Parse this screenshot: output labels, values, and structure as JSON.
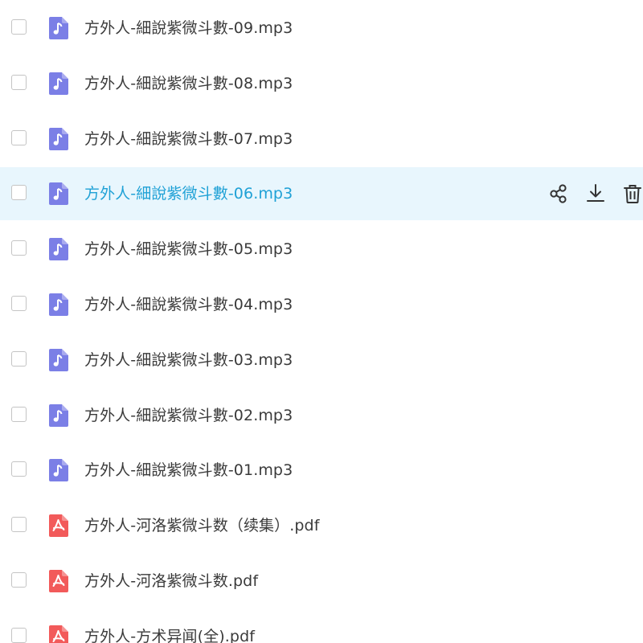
{
  "files": [
    {
      "name": "方外人-細說紫微斗數-09.mp3",
      "type": "audio",
      "icon": "music-note-icon",
      "selected": false
    },
    {
      "name": "方外人-細說紫微斗數-08.mp3",
      "type": "audio",
      "icon": "music-note-icon",
      "selected": false
    },
    {
      "name": "方外人-細說紫微斗數-07.mp3",
      "type": "audio",
      "icon": "music-note-icon",
      "selected": false
    },
    {
      "name": "方外人-細說紫微斗數-06.mp3",
      "type": "audio",
      "icon": "music-note-icon",
      "selected": true
    },
    {
      "name": "方外人-細說紫微斗數-05.mp3",
      "type": "audio",
      "icon": "music-note-icon",
      "selected": false
    },
    {
      "name": "方外人-細說紫微斗數-04.mp3",
      "type": "audio",
      "icon": "music-note-icon",
      "selected": false
    },
    {
      "name": "方外人-細說紫微斗數-03.mp3",
      "type": "audio",
      "icon": "music-note-icon",
      "selected": false
    },
    {
      "name": "方外人-細說紫微斗數-02.mp3",
      "type": "audio",
      "icon": "music-note-icon",
      "selected": false
    },
    {
      "name": "方外人-細說紫微斗數-01.mp3",
      "type": "audio",
      "icon": "music-note-icon",
      "selected": false
    },
    {
      "name": "方外人-河洛紫微斗数（续集）.pdf",
      "type": "pdf",
      "icon": "pdf-icon",
      "selected": false
    },
    {
      "name": "方外人-河洛紫微斗数.pdf",
      "type": "pdf",
      "icon": "pdf-icon",
      "selected": false
    },
    {
      "name": "方外人-方术异闻(全).pdf",
      "type": "pdf",
      "icon": "pdf-icon",
      "selected": false
    }
  ],
  "row_actions": [
    {
      "name": "share",
      "icon": "share-icon"
    },
    {
      "name": "download",
      "icon": "download-icon"
    },
    {
      "name": "delete",
      "icon": "trash-icon"
    }
  ],
  "colors": {
    "audio_icon": "#7b7fe6",
    "pdf_icon": "#f25a5a",
    "selected_row_bg": "#e8f6fd",
    "selected_text": "#1fa1d6",
    "text": "#3a3a3a",
    "action_icon": "#333333"
  }
}
